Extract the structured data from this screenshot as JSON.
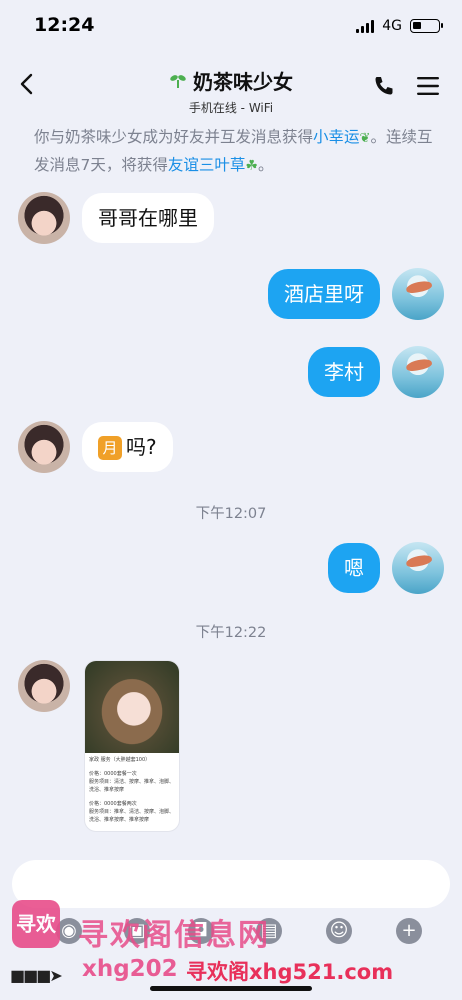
{
  "status": {
    "time": "12:24",
    "network": "4G"
  },
  "header": {
    "title": "奶茶味少女",
    "subtitle": "手机在线 - WiFi"
  },
  "notice": {
    "part1": "你与奶茶味少女成为好友并互发消息获得",
    "link1": "小幸运",
    "part2": "。连续互发消息7天，将获得",
    "link2": "友谊三叶草",
    "part3": "。"
  },
  "messages": [
    {
      "from": "them",
      "text": "哥哥在哪里"
    },
    {
      "from": "me",
      "text": "酒店里呀"
    },
    {
      "from": "me",
      "text": "李村"
    },
    {
      "from": "them",
      "emoji": "月",
      "text": "吗?"
    },
    {
      "from": "me",
      "text": "嗯"
    }
  ],
  "time_separators": [
    "下午12:07",
    "下午12:22"
  ],
  "card": {
    "title": "家政 服务（大胖越套100）",
    "line1": "价格：0000套餐一次",
    "line2": "服务项目：清洁、按摩、推拿、泡脚、洗浴、推拿按摩",
    "line3": "价格：0000套餐两次",
    "line4": "服务项目：推拿、清洁、按摩、泡脚、洗浴、推拿按摩、推拿按摩"
  },
  "watermark": {
    "logo": "寻欢",
    "line1": "寻欢阁信息网",
    "line2": "xhg202",
    "line3": "寻欢阁xhg521.com"
  }
}
